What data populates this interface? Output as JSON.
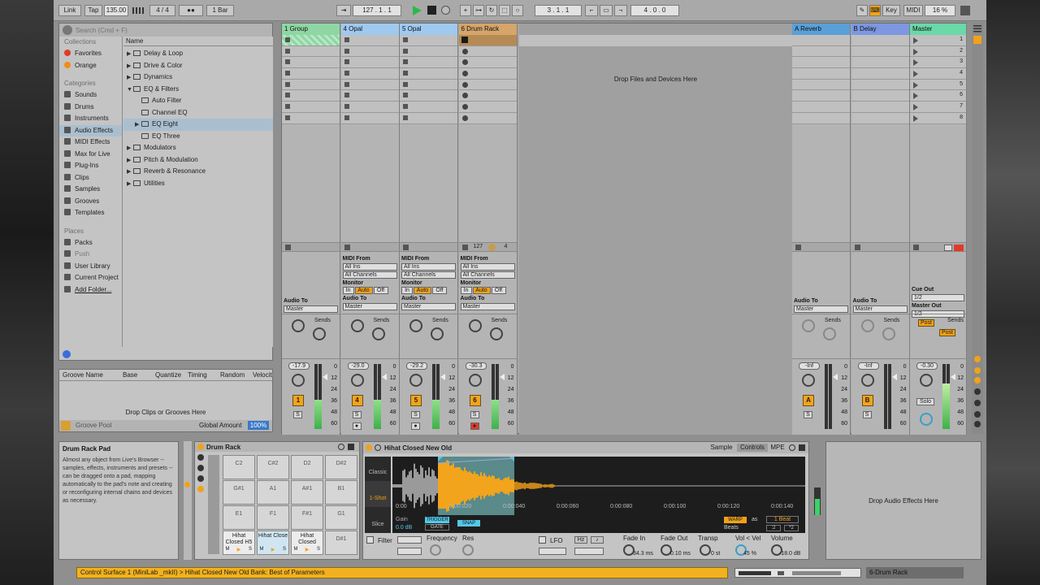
{
  "topbar": {
    "link": "Link",
    "tap": "Tap",
    "tempo": "135.00",
    "signature": "4 / 4",
    "metro": "●●",
    "quantize": "1 Bar",
    "arrangement_pos": "127 .  1 .  1",
    "punch_in": "3 .  1 .  1",
    "loop_length": "4 .  0 .  0",
    "key": "Key",
    "midi": "MIDI",
    "cpu": "16 %"
  },
  "browser": {
    "search_placeholder": "Search (Cmd + F)",
    "collections_title": "Collections",
    "collections": [
      {
        "label": "Favorites",
        "color": "#e23a2a"
      },
      {
        "label": "Orange",
        "color": "#f08c18"
      }
    ],
    "categories_title": "Categories",
    "categories": [
      "Sounds",
      "Drums",
      "Instruments",
      "Audio Effects",
      "MIDI Effects",
      "Max for Live",
      "Plug-Ins",
      "Clips",
      "Samples",
      "Grooves",
      "Templates"
    ],
    "places_title": "Places",
    "places": [
      "Packs",
      "Push",
      "User Library",
      "Current Project",
      "Add Folder..."
    ],
    "name_header": "Name",
    "files": [
      {
        "label": "Delay & Loop",
        "indent": 0,
        "arrow": "▶"
      },
      {
        "label": "Drive & Color",
        "indent": 0,
        "arrow": "▶"
      },
      {
        "label": "Dynamics",
        "indent": 0,
        "arrow": "▶"
      },
      {
        "label": "EQ & Filters",
        "indent": 0,
        "arrow": "▼"
      },
      {
        "label": "Auto Filter",
        "indent": 1,
        "arrow": ""
      },
      {
        "label": "Channel EQ",
        "indent": 1,
        "arrow": ""
      },
      {
        "label": "EQ Eight",
        "indent": 1,
        "arrow": "▶"
      },
      {
        "label": "EQ Three",
        "indent": 1,
        "arrow": ""
      },
      {
        "label": "Modulators",
        "indent": 0,
        "arrow": "▶"
      },
      {
        "label": "Pitch & Modulation",
        "indent": 0,
        "arrow": "▶"
      },
      {
        "label": "Reverb & Resonance",
        "indent": 0,
        "arrow": "▶"
      },
      {
        "label": "Utilities",
        "indent": 0,
        "arrow": "▶"
      }
    ]
  },
  "groove": {
    "cols": [
      "Groove Name",
      "Base",
      "Quantize",
      "Timing",
      "Random",
      "Velocit"
    ],
    "drop": "Drop Clips or Grooves Here",
    "pool": "Groove Pool",
    "global_amount_label": "Global Amount",
    "global_amount": "100%"
  },
  "tracks": [
    {
      "name": "1 Group",
      "color": "#8fd6a4",
      "vol": "-17.9",
      "num": "1",
      "type": "group"
    },
    {
      "name": "4 Opal",
      "color": "#9fc9ef",
      "vol": "-29.0",
      "num": "4",
      "type": "midi"
    },
    {
      "name": "5 Opal",
      "color": "#9fc9ef",
      "vol": "-29.2",
      "num": "5",
      "type": "midi"
    },
    {
      "name": "6 Drum Rack",
      "color": "#d5a56b",
      "vol": "-30.3",
      "num": "6",
      "type": "midi"
    }
  ],
  "returns": [
    {
      "name": "A Reverb",
      "color": "#5aa0d8",
      "vol": "-Inf",
      "num": "A"
    },
    {
      "name": "B Delay",
      "color": "#7d98e0",
      "vol": "-Inf",
      "num": "B"
    }
  ],
  "master": {
    "name": "Master",
    "color": "#6bd8a8",
    "vol": "-0.30",
    "solo": "Solo",
    "cue_out": "Cue Out",
    "master_out": "Master Out",
    "routing": "1/2",
    "post": "Post"
  },
  "session": {
    "drop_text": "Drop Files and Devices Here",
    "scenes": [
      "1",
      "2",
      "3",
      "4",
      "5",
      "6",
      "7",
      "8"
    ],
    "midi_from": "MIDI From",
    "all_ins": "All Ins",
    "all_channels": "All Channels",
    "monitor": "Monitor",
    "in": "In",
    "auto": "Auto",
    "off": "Off",
    "audio_to": "Audio To",
    "master_route": "Master",
    "sends": "Sends",
    "drum_rack_num": "127",
    "drum_rack_count": "4",
    "scale": [
      "0",
      "12",
      "24",
      "36",
      "48",
      "60"
    ]
  },
  "info": {
    "title": "Drum Rack Pad",
    "body": "Almost any object from Live's Browser -- samples, effects, instruments and presets -- can be dragged onto a pad, mapping automatically to the pad's note and creating or reconfiguring internal chains and devices as necessary."
  },
  "drumrack": {
    "title": "Drum Rack",
    "pads": [
      "C2",
      "C#2",
      "D2",
      "D#2",
      "G#1",
      "A1",
      "A#1",
      "B1",
      "E1",
      "F1",
      "F#1",
      "G1",
      "Hihat Closed H5",
      "Hihat Close",
      "Hihat Closed",
      "D#1"
    ]
  },
  "sampler": {
    "title": "Hihat Closed New Old",
    "tabs": [
      "Sample",
      "Controls",
      "MPE"
    ],
    "modes": [
      "Classic",
      "1-Shot",
      "Slice"
    ],
    "timeline": [
      "0:00",
      "0:00:020",
      "0:00:040",
      "0:00:060",
      "0:00:080",
      "0:00:100",
      "0:00:120",
      "0:00:140"
    ],
    "gain_label": "Gain",
    "gain": "0.0 dB",
    "trigger": "TRIGGER",
    "gate": "GATE",
    "snap": "SNAP",
    "warp": "WARP",
    "as": "as",
    "beat": "1 Beat",
    "beats": "Beats",
    "half": ":2",
    "double": "*2",
    "filter": "Filter",
    "frequency": "Frequency",
    "res": "Res",
    "lfo": "LFO",
    "hz": "Hz",
    "fade_in": "Fade In",
    "fade_in_val": "34.3 ms",
    "fade_out": "Fade Out",
    "fade_out_val": "0.10 ms",
    "transp": "Transp",
    "transp_val": "0 st",
    "vol_vel": "Vol < Vel",
    "vol_vel_val": "45 %",
    "volume": "Volume",
    "volume_val": "-18.0 dB"
  },
  "dropfx": "Drop Audio Effects Here",
  "status": {
    "text": "Control Surface 1 (MiniLab _mkII) > Hihat Closed New Old Bank: Best of Parameters",
    "track_label": "6-Drum Rack"
  }
}
